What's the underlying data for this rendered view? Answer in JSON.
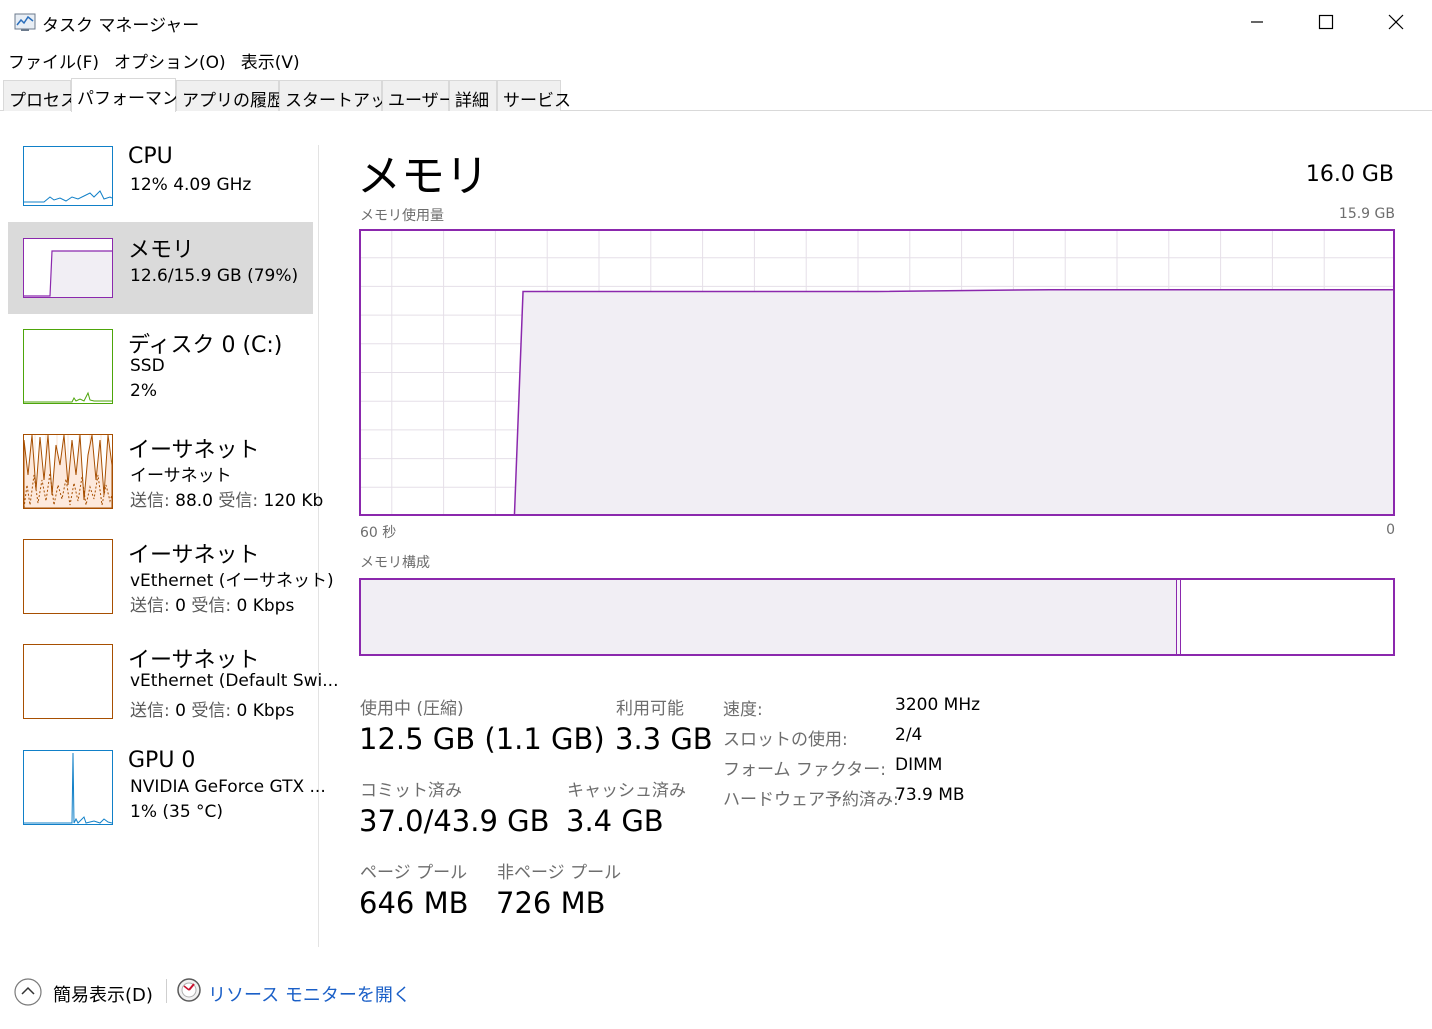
{
  "window": {
    "title": "タスク マネージャー",
    "minimize_glyph": "—",
    "maximize_glyph": "☐",
    "close_glyph": "✕"
  },
  "menu": {
    "items": [
      "ファイル(F)",
      "オプション(O)",
      "表示(V)"
    ]
  },
  "tabs": [
    {
      "label": "プロセス",
      "active": false
    },
    {
      "label": "パフォーマンス",
      "active": true
    },
    {
      "label": "アプリの履歴",
      "active": false
    },
    {
      "label": "スタートアップ",
      "active": false
    },
    {
      "label": "ユーザー",
      "active": false
    },
    {
      "label": "詳細",
      "active": false
    },
    {
      "label": "サービス",
      "active": false
    }
  ],
  "sidebar": {
    "items": [
      {
        "title": "CPU",
        "line1": "12%  4.09 GHz",
        "color": "#1180c8"
      },
      {
        "title": "メモリ",
        "line1": "12.6/15.9 GB (79%)",
        "color": "#8b28ad",
        "selected": true
      },
      {
        "title": "ディスク 0 (C:)",
        "line1": "SSD",
        "line2": "2%",
        "color": "#4da50a"
      },
      {
        "title": "イーサネット",
        "line1": "イーサネット",
        "send_label": "送信:",
        "send_value": "88.0",
        "recv_label": "受信:",
        "recv_value": "120 Kb",
        "color": "#a74f01"
      },
      {
        "title": "イーサネット",
        "line1": "vEthernet (イーサネット)",
        "send_label": "送信:",
        "send_value": "0",
        "recv_label": "受信:",
        "recv_value": "0 Kbps",
        "color": "#a74f01"
      },
      {
        "title": "イーサネット",
        "line1": "vEthernet (Default Swi...",
        "send_label": "送信:",
        "send_value": "0",
        "recv_label": "受信:",
        "recv_value": "0 Kbps",
        "color": "#a74f01"
      },
      {
        "title": "GPU 0",
        "line1": "NVIDIA GeForce GTX ...",
        "line2": "1% (35 °C)",
        "color": "#1180c8"
      }
    ]
  },
  "main": {
    "title": "メモリ",
    "total": "16.0 GB",
    "usage_label": "メモリ使用量",
    "usage_max": "15.9 GB",
    "time_left": "60 秒",
    "time_right": "0",
    "composition_label": "メモリ構成",
    "accent_color": "#8b28ad",
    "fill_color": "#f1eef4",
    "grid_color": "#e5dfe8"
  },
  "chart_data": {
    "type": "area",
    "title": "メモリ使用量",
    "xlabel": "",
    "ylabel": "",
    "x": [
      60,
      51,
      50.5,
      30,
      20,
      15,
      10,
      5,
      0
    ],
    "values": [
      0,
      0,
      12.5,
      12.5,
      12.6,
      12.6,
      12.6,
      12.6,
      12.6
    ],
    "ylim": [
      0,
      15.9
    ],
    "xlim": [
      60,
      0
    ],
    "grid": true
  },
  "composition": {
    "in_use_fraction": 0.79,
    "modified_fraction": 0.005
  },
  "stats": {
    "in_use_label": "使用中 (圧縮)",
    "in_use_value": "12.5 GB (1.1 GB)",
    "available_label": "利用可能",
    "available_value": "3.3 GB",
    "committed_label": "コミット済み",
    "committed_value": "37.0/43.9 GB",
    "cached_label": "キャッシュ済み",
    "cached_value": "3.4 GB",
    "paged_label": "ページ プール",
    "paged_value": "646 MB",
    "nonpaged_label": "非ページ プール",
    "nonpaged_value": "726 MB"
  },
  "details": [
    {
      "label": "速度:",
      "value": "3200 MHz"
    },
    {
      "label": "スロットの使用:",
      "value": "2/4"
    },
    {
      "label": "フォーム ファクター:",
      "value": "DIMM"
    },
    {
      "label": "ハードウェア予約済み:",
      "value": "73.9 MB"
    }
  ],
  "footer": {
    "fewer_details": "簡易表示(D)",
    "resource_monitor": "リソース モニターを開く"
  }
}
